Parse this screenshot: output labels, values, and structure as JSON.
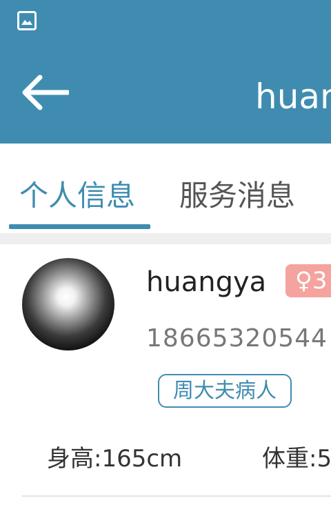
{
  "appbar": {
    "title": "huan",
    "status_icon": "image-icon",
    "back_icon": "arrow-left-icon",
    "color": "#3f8cb0"
  },
  "tabs": [
    {
      "label": "个人信息",
      "active": true
    },
    {
      "label": "服务消息",
      "active": false
    }
  ],
  "profile": {
    "name": "huangya",
    "gender_symbol": "♀",
    "gender_extra": "3",
    "phone": "18665320544",
    "tag": "周大夫病人",
    "height": "身高:165cm",
    "weight": "体重:5",
    "gender_badge_color": "#f5a39f"
  }
}
